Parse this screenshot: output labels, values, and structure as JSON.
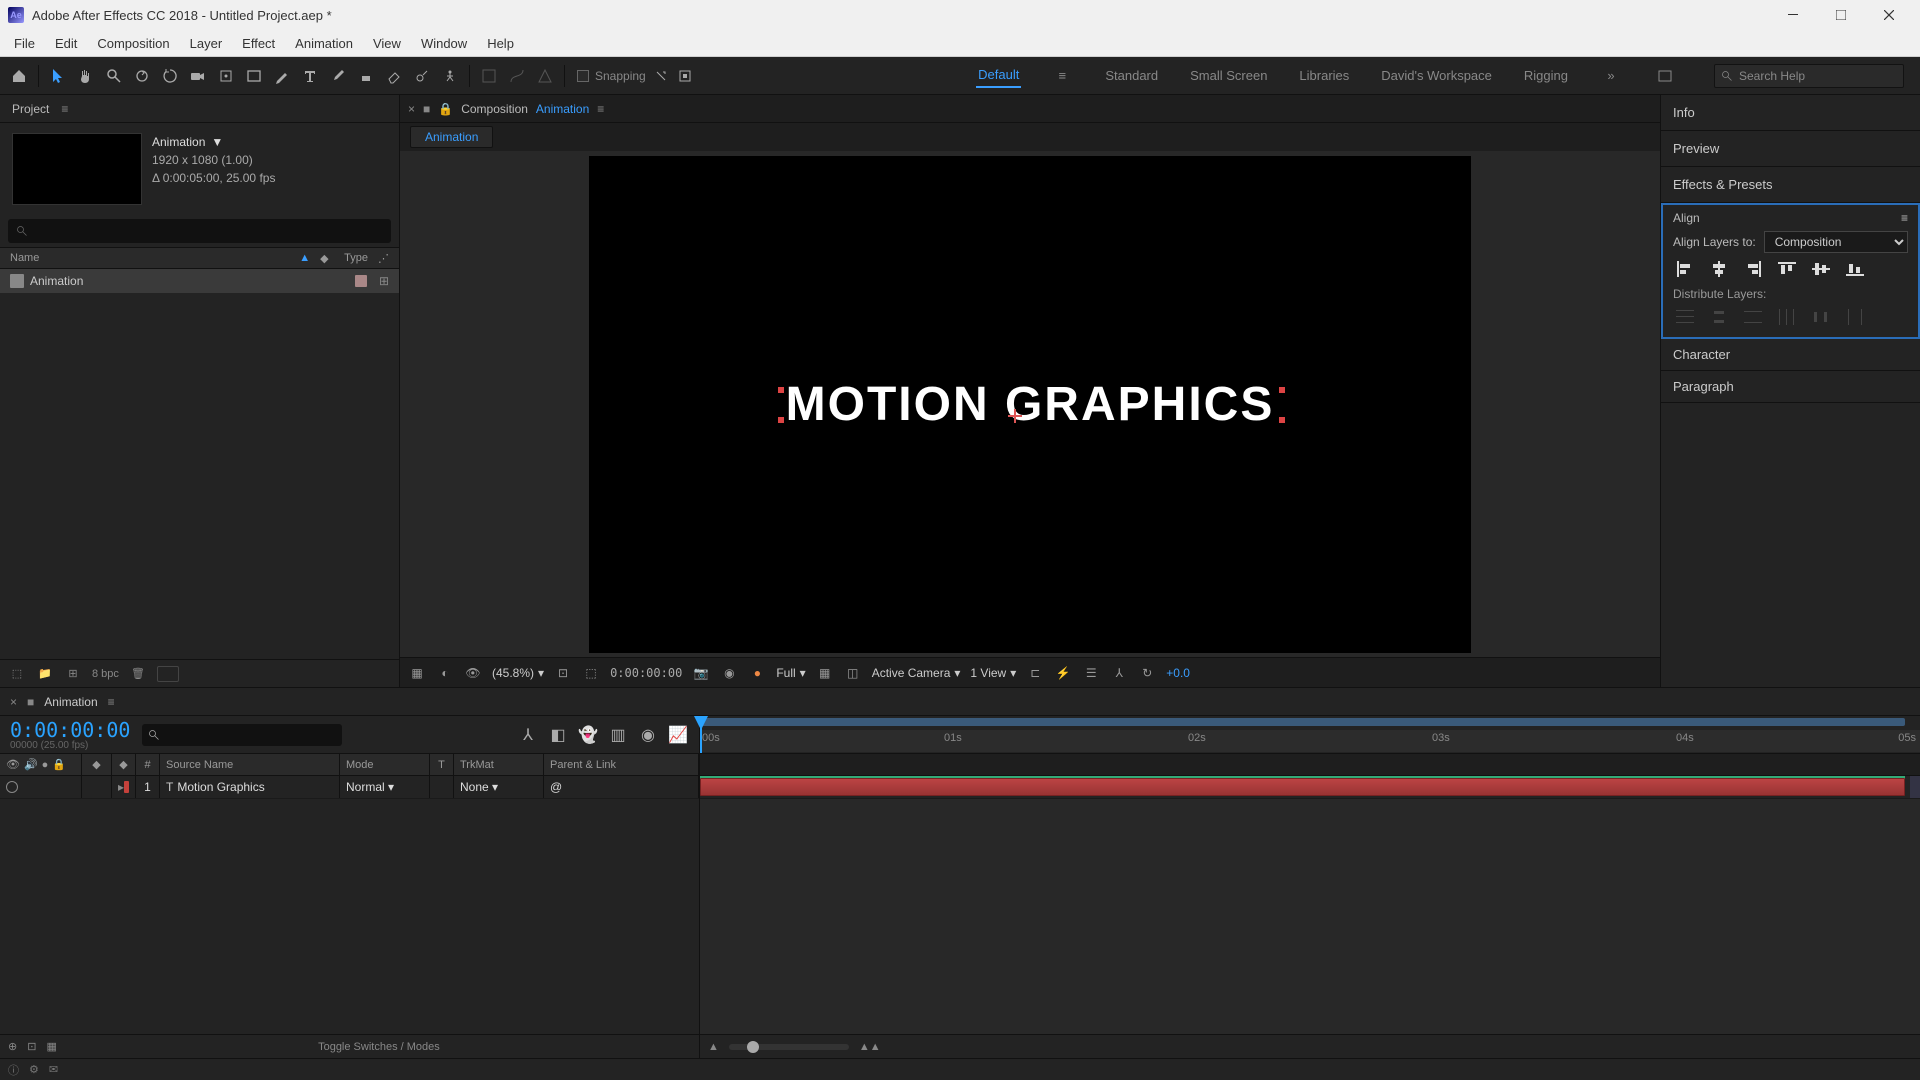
{
  "window": {
    "title": "Adobe After Effects CC 2018 - Untitled Project.aep *"
  },
  "menu": [
    "File",
    "Edit",
    "Composition",
    "Layer",
    "Effect",
    "Animation",
    "View",
    "Window",
    "Help"
  ],
  "toolbar": {
    "snapping_label": "Snapping",
    "workspaces": [
      "Default",
      "Standard",
      "Small Screen",
      "Libraries",
      "David's Workspace",
      "Rigging"
    ],
    "active_workspace": "Default",
    "search_placeholder": "Search Help"
  },
  "project": {
    "panel_title": "Project",
    "comp": {
      "name": "Animation",
      "dimensions": "1920 x 1080 (1.00)",
      "duration": "Δ 0:00:05:00, 25.00 fps"
    },
    "columns": {
      "name": "Name",
      "type": "Type"
    },
    "rows": [
      {
        "name": "Animation"
      }
    ],
    "bpc": "8 bpc"
  },
  "viewer": {
    "comp_label": "Composition",
    "comp_name": "Animation",
    "flowchart_tab": "Animation",
    "stage_text": "MOTION GRAPHICS",
    "footer": {
      "zoom": "(45.8%)",
      "timecode": "0:00:00:00",
      "resolution": "Full",
      "camera": "Active Camera",
      "views": "1 View",
      "exposure": "+0.0"
    }
  },
  "right": {
    "info": "Info",
    "preview": "Preview",
    "effects": "Effects & Presets",
    "align": {
      "title": "Align",
      "align_to_label": "Align Layers to:",
      "align_to_value": "Composition",
      "distribute_label": "Distribute Layers:"
    },
    "character": "Character",
    "paragraph": "Paragraph"
  },
  "timeline": {
    "tab": "Animation",
    "timecode": "0:00:00:00",
    "timecode_sub": "00000 (25.00 fps)",
    "columns": {
      "num": "#",
      "source": "Source Name",
      "mode": "Mode",
      "t": "T",
      "trkmat": "TrkMat",
      "parent": "Parent & Link"
    },
    "layers": [
      {
        "num": "1",
        "name": "Motion Graphics",
        "mode": "Normal",
        "trkmat": "None"
      }
    ],
    "ticks": [
      "00s",
      "01s",
      "02s",
      "03s",
      "04s",
      "05s"
    ],
    "footer_toggle": "Toggle Switches / Modes"
  }
}
